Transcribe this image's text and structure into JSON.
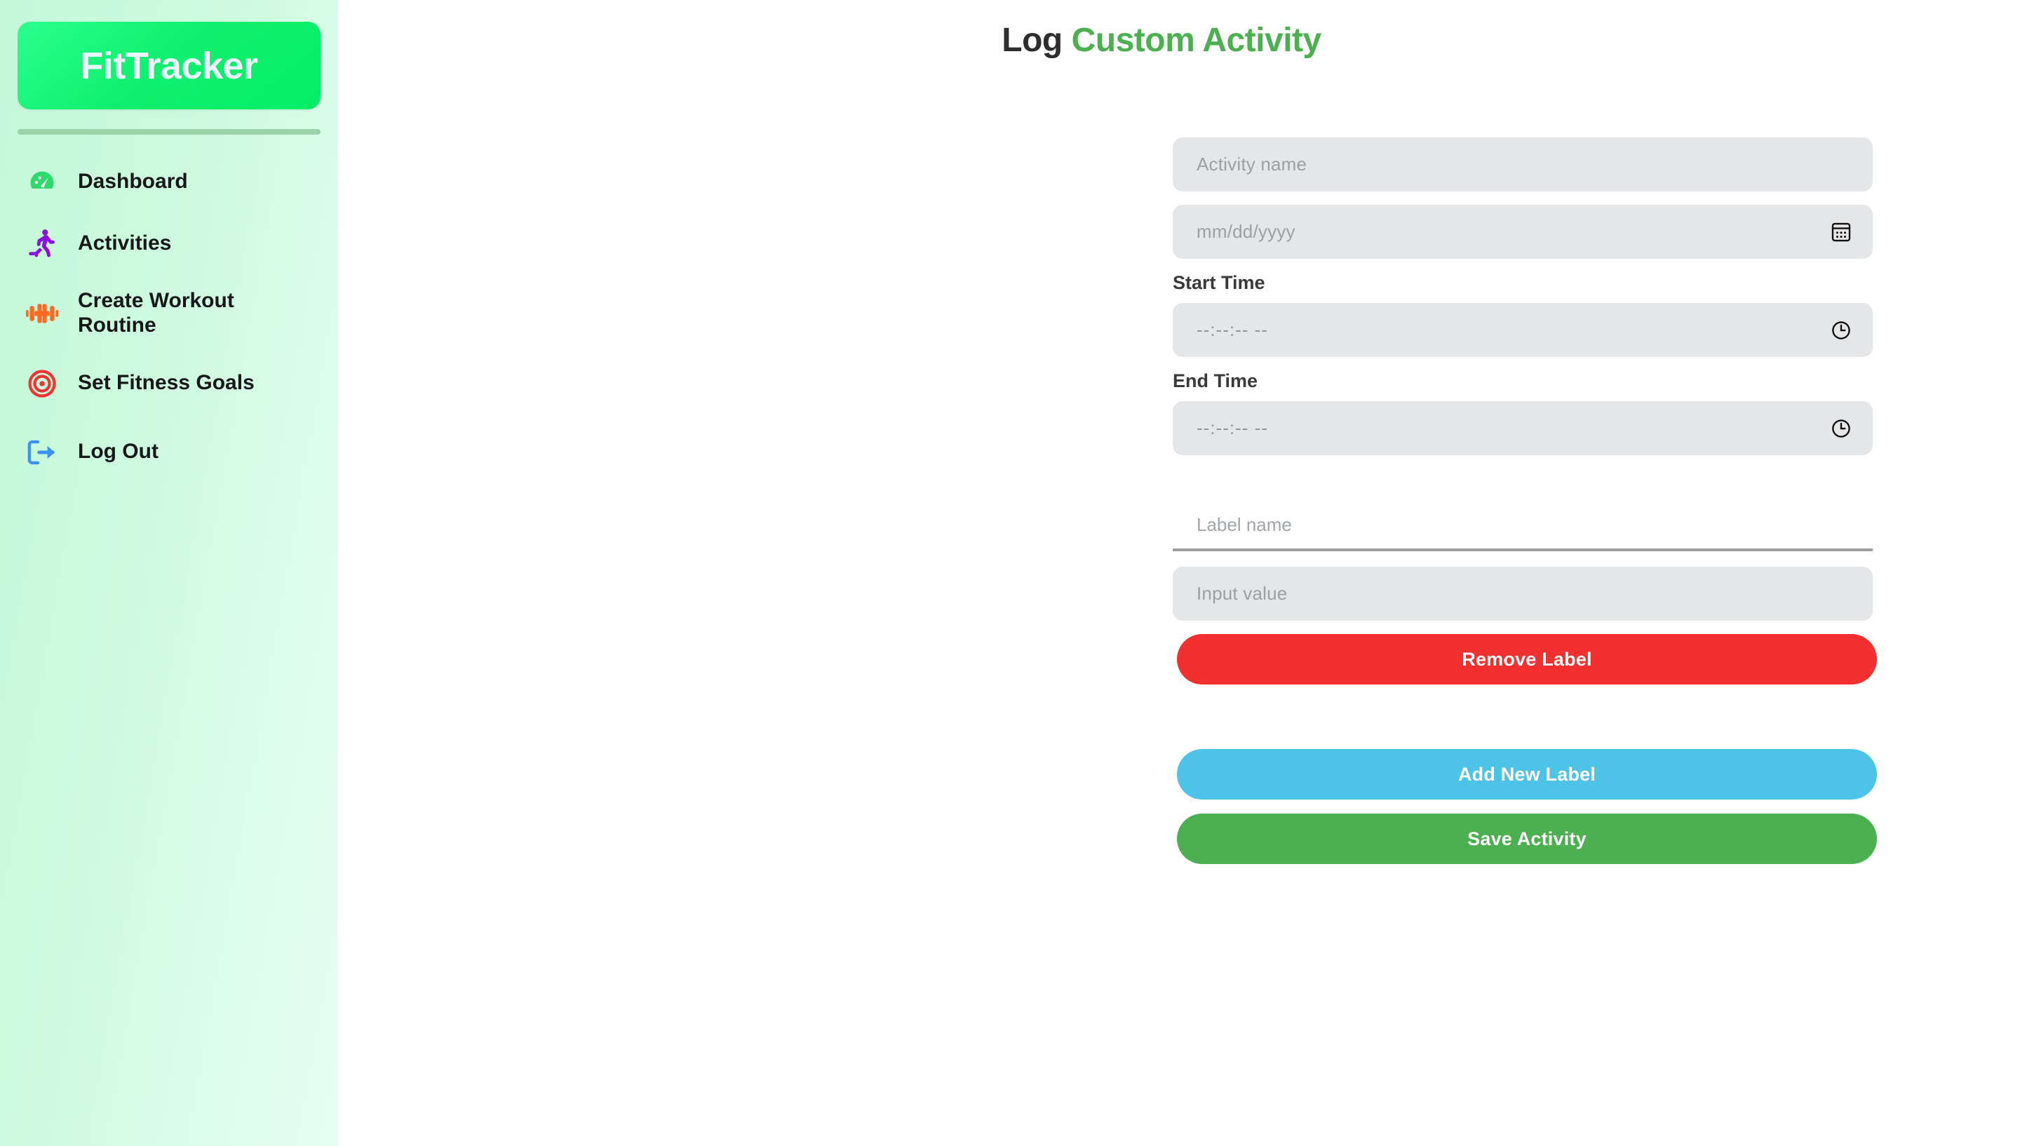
{
  "brand": {
    "name": "FitTracker",
    "logo_gradient_from": "#2aff8e",
    "logo_gradient_to": "#05ee66",
    "sidebar_bg_from": "#c4f8d9",
    "sidebar_bg_to": "#e6fff3"
  },
  "sidebar": {
    "items": [
      {
        "label": "Dashboard",
        "icon": "speedometer-icon",
        "color": "#2fd96b"
      },
      {
        "label": "Activities",
        "icon": "running-person-icon",
        "color": "#8a10e0"
      },
      {
        "label": "Create Workout Routine",
        "icon": "dumbbell-icon",
        "color": "#ff6a23"
      },
      {
        "label": "Set Fitness Goals",
        "icon": "target-icon",
        "color": "#f43232"
      },
      {
        "label": "Log Out",
        "icon": "logout-icon",
        "color": "#3b93f7"
      }
    ]
  },
  "header": {
    "title_prefix": "Log",
    "title_accent": "Custom Activity",
    "accent_color": "#4caf50"
  },
  "form": {
    "activity_name": {
      "placeholder": "Activity name",
      "value": ""
    },
    "date": {
      "placeholder": "mm/dd/yyyy",
      "value": "",
      "icon": "calendar-icon"
    },
    "start_time": {
      "label": "Start Time",
      "placeholder": "--:--:-- --",
      "value": "",
      "icon": "clock-icon"
    },
    "end_time": {
      "label": "End Time",
      "placeholder": "--:--:-- --",
      "value": "",
      "icon": "clock-icon"
    },
    "label_name": {
      "placeholder": "Label name",
      "value": ""
    },
    "input_value": {
      "placeholder": "Input value",
      "value": ""
    }
  },
  "buttons": {
    "remove_label": {
      "text": "Remove Label",
      "color": "#f23030"
    },
    "add_label": {
      "text": "Add New Label",
      "color": "#4ec3e8"
    },
    "save": {
      "text": "Save Activity",
      "color": "#4caf50"
    }
  }
}
